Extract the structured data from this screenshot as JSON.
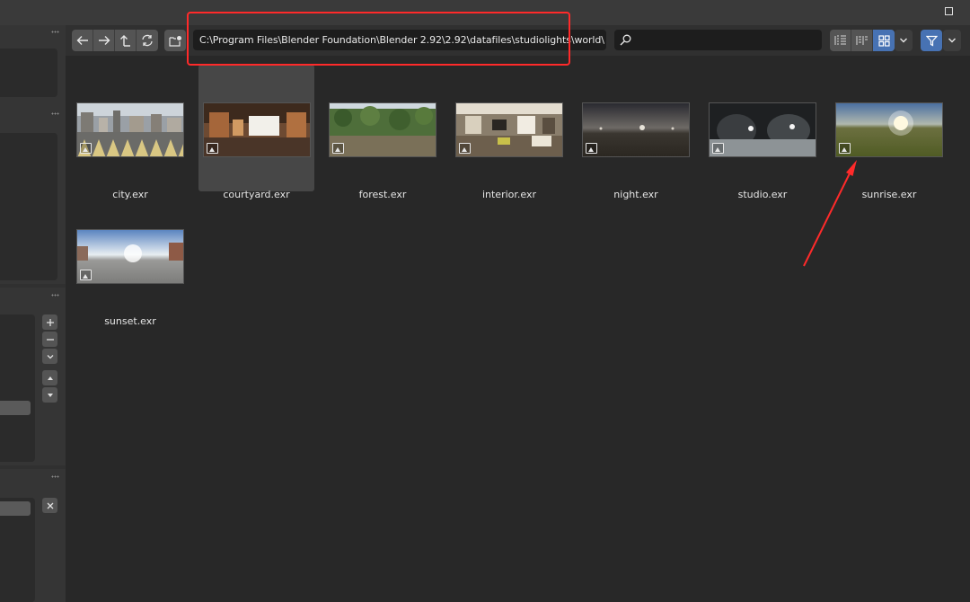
{
  "window": {
    "maximize_icon": "maximize-icon"
  },
  "toolbar": {
    "nav_icons": [
      "back-arrow-icon",
      "forward-arrow-icon",
      "parent-directory-icon",
      "refresh-icon"
    ],
    "new_folder_icon": "new-folder-icon",
    "path_value": "C:\\Program Files\\Blender Foundation\\Blender 2.92\\2.92\\datafiles\\studiolights\\world\\",
    "search_value": "",
    "search_icon": "search-icon",
    "display_modes": [
      "vertical-list-icon",
      "horizontal-list-icon",
      "thumbnails-icon"
    ],
    "active_display_mode": "thumbnails",
    "filter_icon": "filter-icon"
  },
  "files": [
    {
      "name": "city.exr",
      "selected": false
    },
    {
      "name": "courtyard.exr",
      "selected": true
    },
    {
      "name": "forest.exr",
      "selected": false
    },
    {
      "name": "interior.exr",
      "selected": false
    },
    {
      "name": "night.exr",
      "selected": false
    },
    {
      "name": "studio.exr",
      "selected": false
    },
    {
      "name": "sunrise.exr",
      "selected": false
    },
    {
      "name": "sunset.exr",
      "selected": false
    }
  ],
  "colors": {
    "accent": "#4772b3",
    "highlight_box": "#ff2a2a",
    "background": "#282828"
  }
}
